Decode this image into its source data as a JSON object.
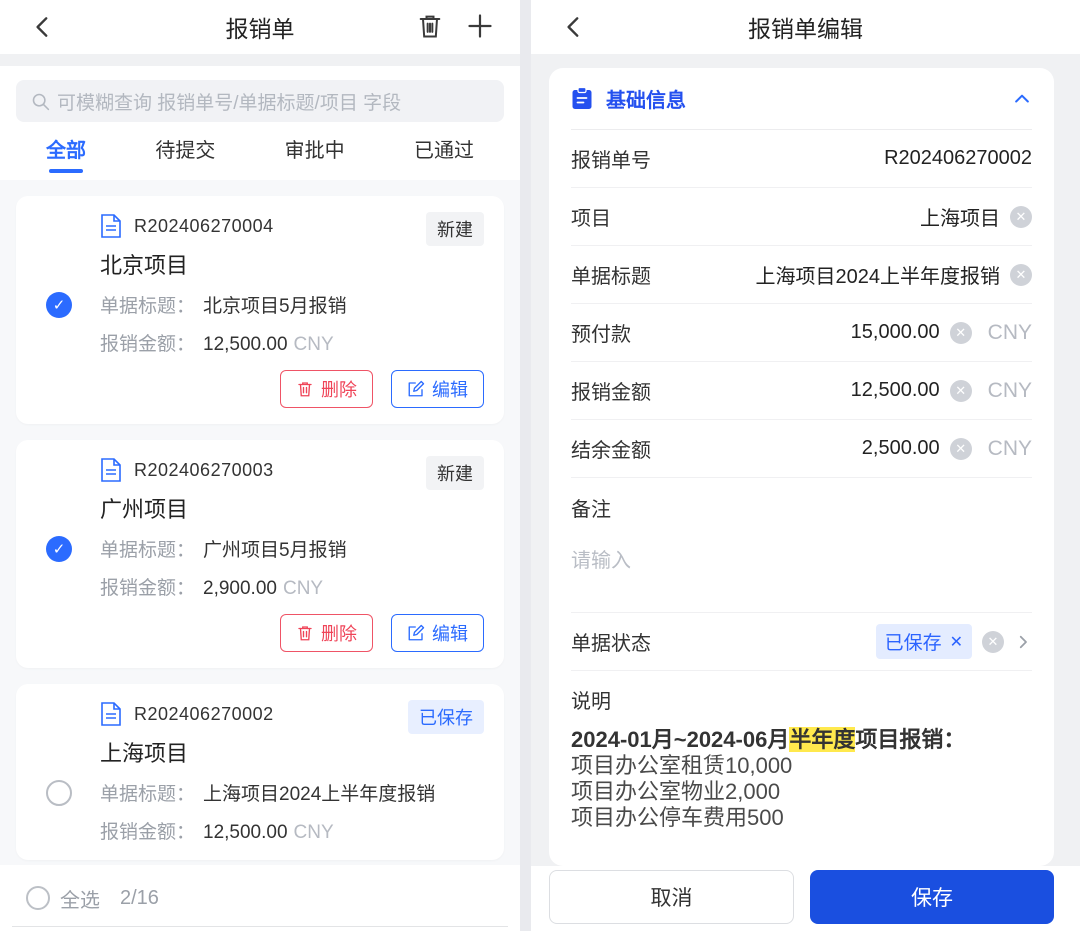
{
  "colors": {
    "accent": "#2b6bff",
    "primary_button": "#1a4fe0",
    "danger": "#ef4458",
    "highlight": "#ffe94d",
    "badge_new_bg": "#f2f3f5",
    "badge_saved_bg": "#e8efff",
    "tag_bg": "#e4ecff"
  },
  "left_panel": {
    "title": "报销单",
    "icons": [
      "trash-icon",
      "plus-icon"
    ],
    "search_placeholder": "可模糊查询 报销单号/单据标题/项目 字段",
    "tabs": [
      {
        "label": "全部",
        "active": true
      },
      {
        "label": "待提交",
        "active": false
      },
      {
        "label": "审批中",
        "active": false
      },
      {
        "label": "已通过",
        "active": false
      }
    ],
    "labels": {
      "doc_title": "单据标题：",
      "amount": "报销金额：",
      "currency": "CNY",
      "delete": "删除",
      "edit": "编辑"
    },
    "cards": [
      {
        "number": "R202406270004",
        "badge": "新建",
        "title": "北京项目",
        "doc_title": "北京项目5月报销",
        "amount": "12,500.00",
        "checked": true
      },
      {
        "number": "R202406270003",
        "badge": "新建",
        "title": "广州项目",
        "doc_title": "广州项目5月报销",
        "amount": "2,900.00",
        "checked": true
      },
      {
        "number": "R202406270002",
        "badge": "已保存",
        "title": "上海项目",
        "doc_title": "上海项目2024上半年度报销",
        "amount": "12,500.00",
        "checked": false
      }
    ],
    "footer": {
      "select_all": "全选",
      "count": "2/16"
    }
  },
  "right_panel": {
    "title": "报销单编辑",
    "section_title": "基础信息",
    "fields": {
      "number": {
        "label": "报销单号",
        "value": "R202406270002"
      },
      "project": {
        "label": "项目",
        "value": "上海项目"
      },
      "doc_title": {
        "label": "单据标题",
        "value": "上海项目2024上半年度报销"
      },
      "advance": {
        "label": "预付款",
        "value": "15,000.00",
        "currency": "CNY"
      },
      "amount": {
        "label": "报销金额",
        "value": "12,500.00",
        "currency": "CNY"
      },
      "balance": {
        "label": "结余金额",
        "value": "2,500.00",
        "currency": "CNY"
      },
      "remark": {
        "label": "备注",
        "placeholder": "请输入"
      },
      "status": {
        "label": "单据状态",
        "tag": "已保存",
        "tag_close": "✕"
      },
      "description": {
        "label": "说明",
        "line1_prefix": "2024-01月~2024-06月",
        "line1_highlight": "半年度",
        "line1_suffix": "项目报销：",
        "lines": [
          "项目办公室租赁10,000",
          "项目办公室物业2,000",
          "项目办公停车费用500"
        ]
      }
    },
    "footer": {
      "cancel": "取消",
      "save": "保存"
    }
  }
}
